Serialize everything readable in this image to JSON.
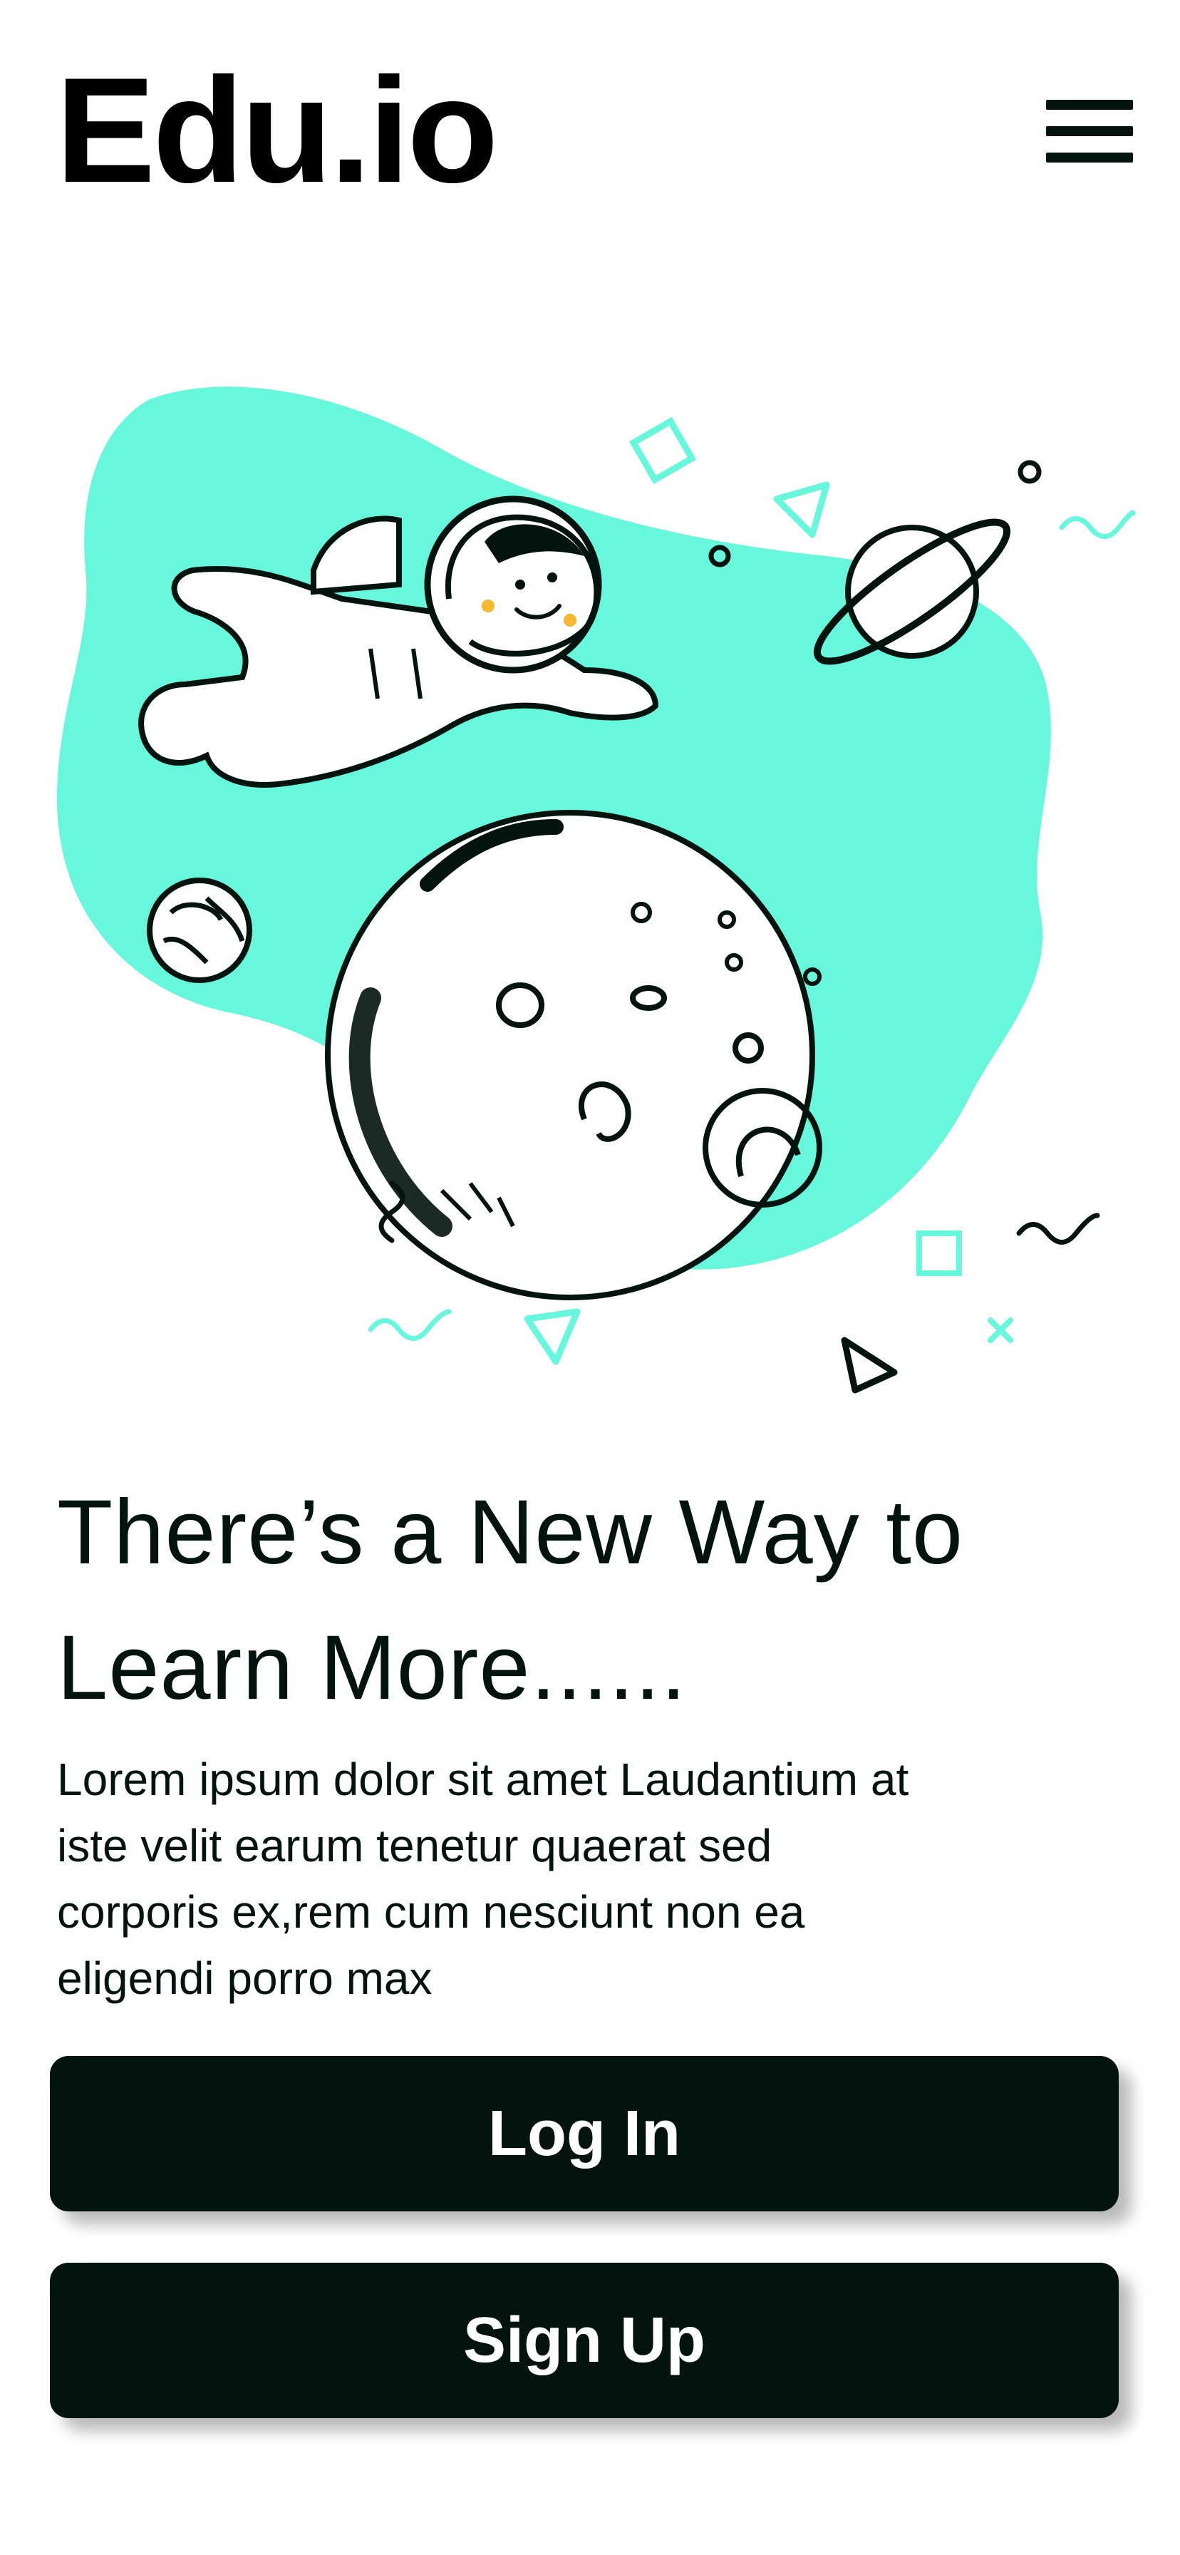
{
  "header": {
    "logo": "Edu.io",
    "menu_icon": "hamburger-menu-icon"
  },
  "colors": {
    "accent": "#66f7dc",
    "dark": "#03130d",
    "background": "#ffffff",
    "cheek": "#f5b82e"
  },
  "hero": {
    "illustration": "astronaut-floating-near-moon"
  },
  "content": {
    "headline_line1": "There’s a New Way to",
    "headline_line2": "Learn More......",
    "body_line1": "Lorem ipsum dolor sit amet Laudantium at",
    "body_line2": "iste velit earum tenetur quaerat sed",
    "body_line3": "corporis ex,rem cum nesciunt non ea",
    "body_line4": "eligendi porro max"
  },
  "buttons": {
    "login_label": "Log In",
    "signup_label": "Sign Up"
  }
}
